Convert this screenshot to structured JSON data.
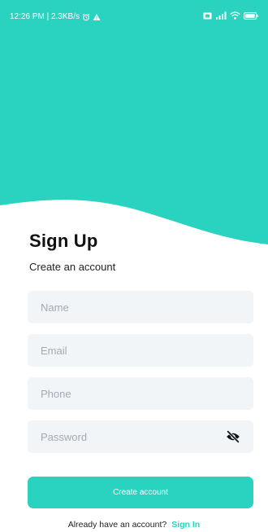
{
  "status_bar": {
    "time_text": "12:26 PM | 2.3KB/s",
    "icons": [
      "alarm-icon",
      "warning-icon",
      "sim-icon",
      "signal-icon",
      "wifi-icon",
      "battery-icon"
    ]
  },
  "colors": {
    "accent": "#2ad3c0",
    "field_bg": "#f2f5f8",
    "title": "#111111"
  },
  "form": {
    "title": "Sign Up",
    "subtitle": "Create an account",
    "name_placeholder": "Name",
    "email_placeholder": "Email",
    "phone_placeholder": "Phone",
    "password_placeholder": "Password",
    "password_toggle_icon": "eye-off-icon",
    "submit_label": "Create account"
  },
  "footer": {
    "prompt": "Already have an account?",
    "link": "Sign In"
  }
}
